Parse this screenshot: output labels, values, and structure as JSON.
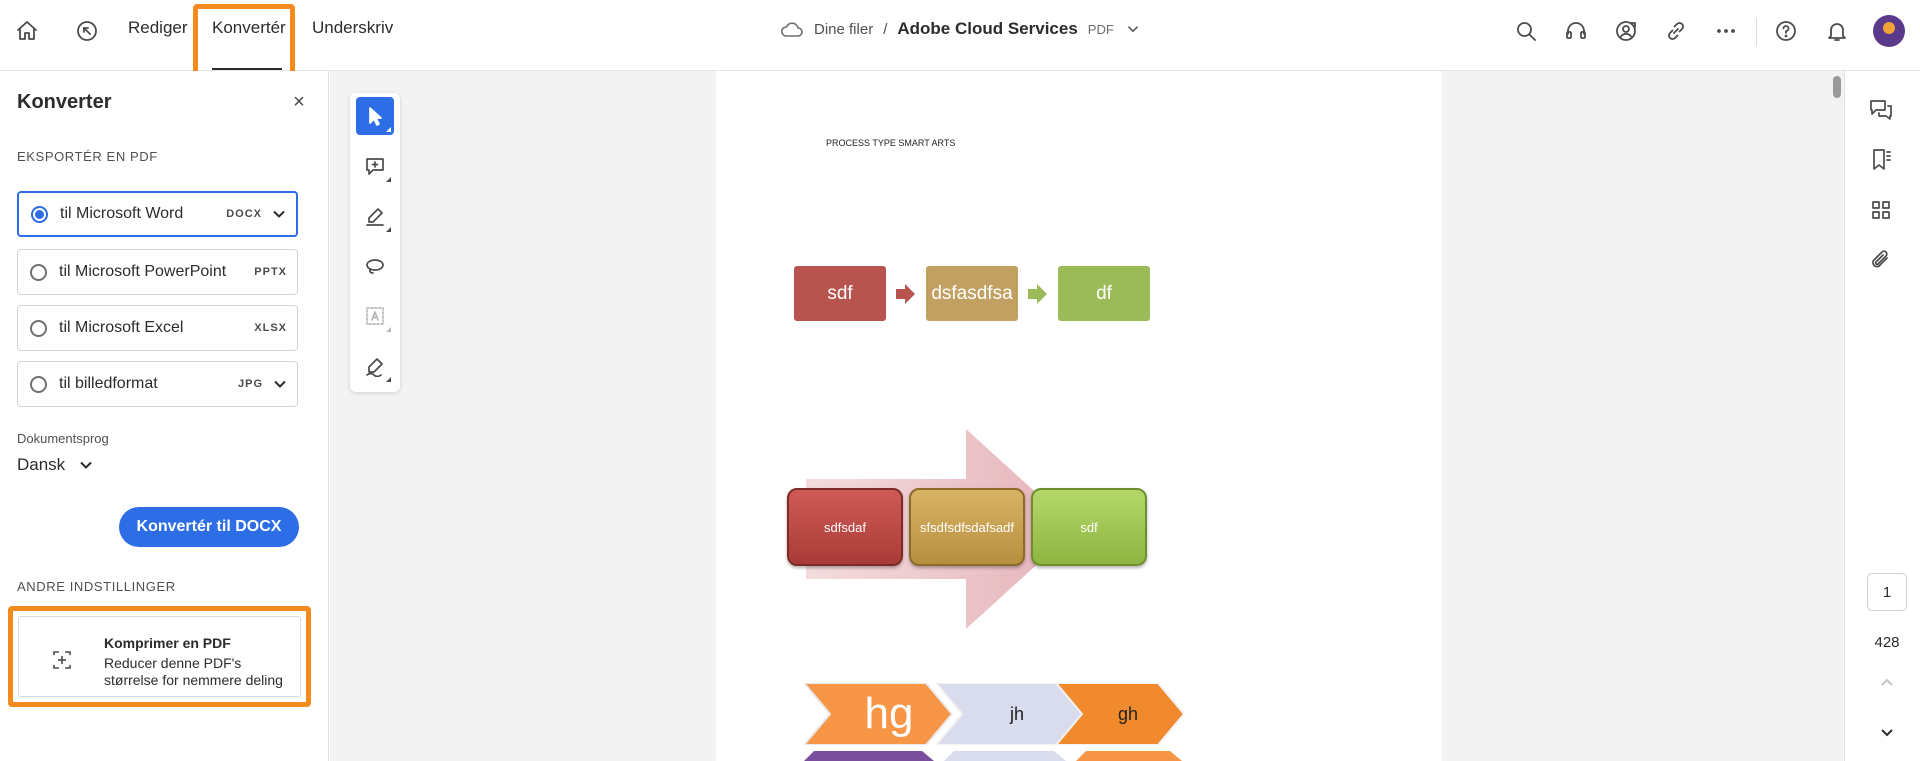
{
  "header": {
    "tabs": [
      {
        "label": "Rediger"
      },
      {
        "label": "Konvertér"
      },
      {
        "label": "Underskriv"
      }
    ],
    "breadcrumb": {
      "root": "Dine filer",
      "separator": "/",
      "doc_title": "Adobe Cloud Services",
      "doc_type": "PDF"
    },
    "icons": [
      "home-icon",
      "history-icon",
      "search-icon",
      "headset-icon",
      "share-user-icon",
      "link-icon",
      "more-icon",
      "help-icon",
      "bell-icon",
      "avatar"
    ]
  },
  "panel": {
    "title": "Konverter",
    "close": "×",
    "export_heading": "EKSPORTÉR EN PDF",
    "options": [
      {
        "label": "til Microsoft Word",
        "format": "DOCX",
        "selected": true,
        "dropdown": true
      },
      {
        "label": "til Microsoft PowerPoint",
        "format": "PPTX",
        "selected": false,
        "dropdown": false
      },
      {
        "label": "til Microsoft Excel",
        "format": "XLSX",
        "selected": false,
        "dropdown": false
      },
      {
        "label": "til billedformat",
        "format": "JPG",
        "selected": false,
        "dropdown": true
      }
    ],
    "language_label": "Dokumentsprog",
    "language_value": "Dansk",
    "convert_button": "Konvertér til DOCX",
    "other_heading": "ANDRE INDSTILLINGER",
    "compress": {
      "title": "Komprimer en PDF",
      "description": "Reducer denne PDF's størrelse for nemmere deling"
    }
  },
  "document": {
    "heading": "PROCESS TYPE SMART ARTS",
    "row1": [
      "sdf",
      "dsfasdfsa",
      "df"
    ],
    "row2": [
      "sdfsdaf",
      "sfsdfsdfsdafsadf",
      "sdf"
    ],
    "row3": [
      "hg",
      "jh",
      "gh"
    ]
  },
  "pagination": {
    "current": "1",
    "total": "428"
  },
  "colors": {
    "accent": "#2d6ee6",
    "highlight": "#f38b1f",
    "red": "#b85450",
    "gold": "#c1a062",
    "green": "#9bbb59",
    "orange": "#f79646",
    "lavender": "#d9dcec"
  }
}
